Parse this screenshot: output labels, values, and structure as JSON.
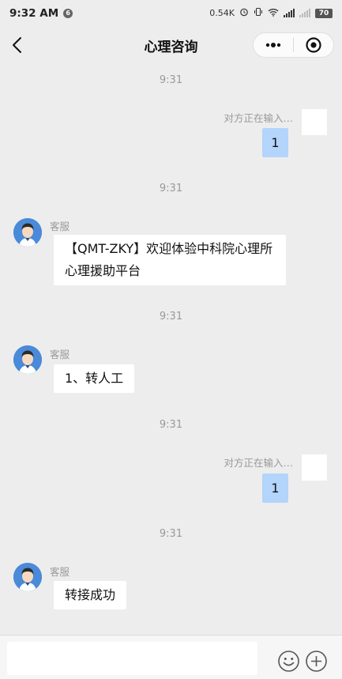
{
  "status_bar": {
    "time": "9:32 AM",
    "notification_count": "6",
    "net_speed": "0.54K",
    "battery": "70"
  },
  "nav": {
    "title": "心理咨询",
    "back_icon": "chevron-left-icon",
    "more_icon": "more-dots-icon",
    "close_icon": "target-close-icon"
  },
  "messages": [
    {
      "kind": "time",
      "text": "9:31"
    },
    {
      "kind": "outgoing",
      "typing": "对方正在输入…",
      "text": "1"
    },
    {
      "kind": "time",
      "text": "9:31"
    },
    {
      "kind": "incoming",
      "sender": "客服",
      "lines": [
        "【QMT-ZKY】欢迎体验中科院心理所",
        "心理援助平台"
      ]
    },
    {
      "kind": "time",
      "text": "9:31"
    },
    {
      "kind": "incoming",
      "sender": "客服",
      "lines": [
        "1、转人工"
      ]
    },
    {
      "kind": "time",
      "text": "9:31"
    },
    {
      "kind": "outgoing",
      "typing": "对方正在输入…",
      "text": "1"
    },
    {
      "kind": "time",
      "text": "9:31"
    },
    {
      "kind": "incoming",
      "sender": "客服",
      "lines": [
        "转接成功"
      ]
    }
  ],
  "input_bar": {
    "value": "",
    "emoji_icon": "emoji-smile-icon",
    "plus_icon": "plus-circle-icon"
  },
  "colors": {
    "background": "#ededed",
    "outgoing_bubble": "#b3d4fb",
    "incoming_bubble": "#ffffff",
    "avatar_blue": "#4a8ad9"
  }
}
